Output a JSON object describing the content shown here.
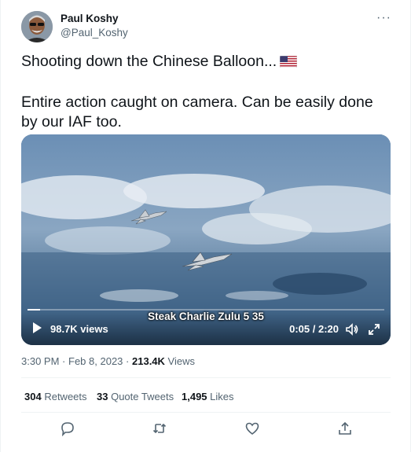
{
  "author": {
    "name": "Paul Koshy",
    "handle": "@Paul_Koshy"
  },
  "more_label": "···",
  "tweet": {
    "line1": "Shooting down the Chinese Balloon...",
    "line2": "Entire action caught on camera. Can be easily done by our IAF too.",
    "flag_icon": "us-flag-emoji"
  },
  "video": {
    "subtitle": "Steak Charlie Zulu 5 35",
    "views": "98.7K views",
    "time": "0:05 / 2:20",
    "progress": 0.036
  },
  "meta": {
    "time": "3:30 PM",
    "separator": "·",
    "date": "Feb 8, 2023",
    "dot": "·",
    "views_count": "213.4K",
    "views_label": "Views"
  },
  "stats": {
    "retweets_count": "304",
    "retweets_label": "Retweets",
    "quotes_count": "33",
    "quotes_label": "Quote Tweets",
    "likes_count": "1,495",
    "likes_label": "Likes"
  },
  "actions": [
    "reply-icon",
    "retweet-icon",
    "like-icon",
    "share-icon"
  ],
  "colors": {
    "text": "#0f1419",
    "secondary": "#536471",
    "divider": "#eff3f4"
  }
}
